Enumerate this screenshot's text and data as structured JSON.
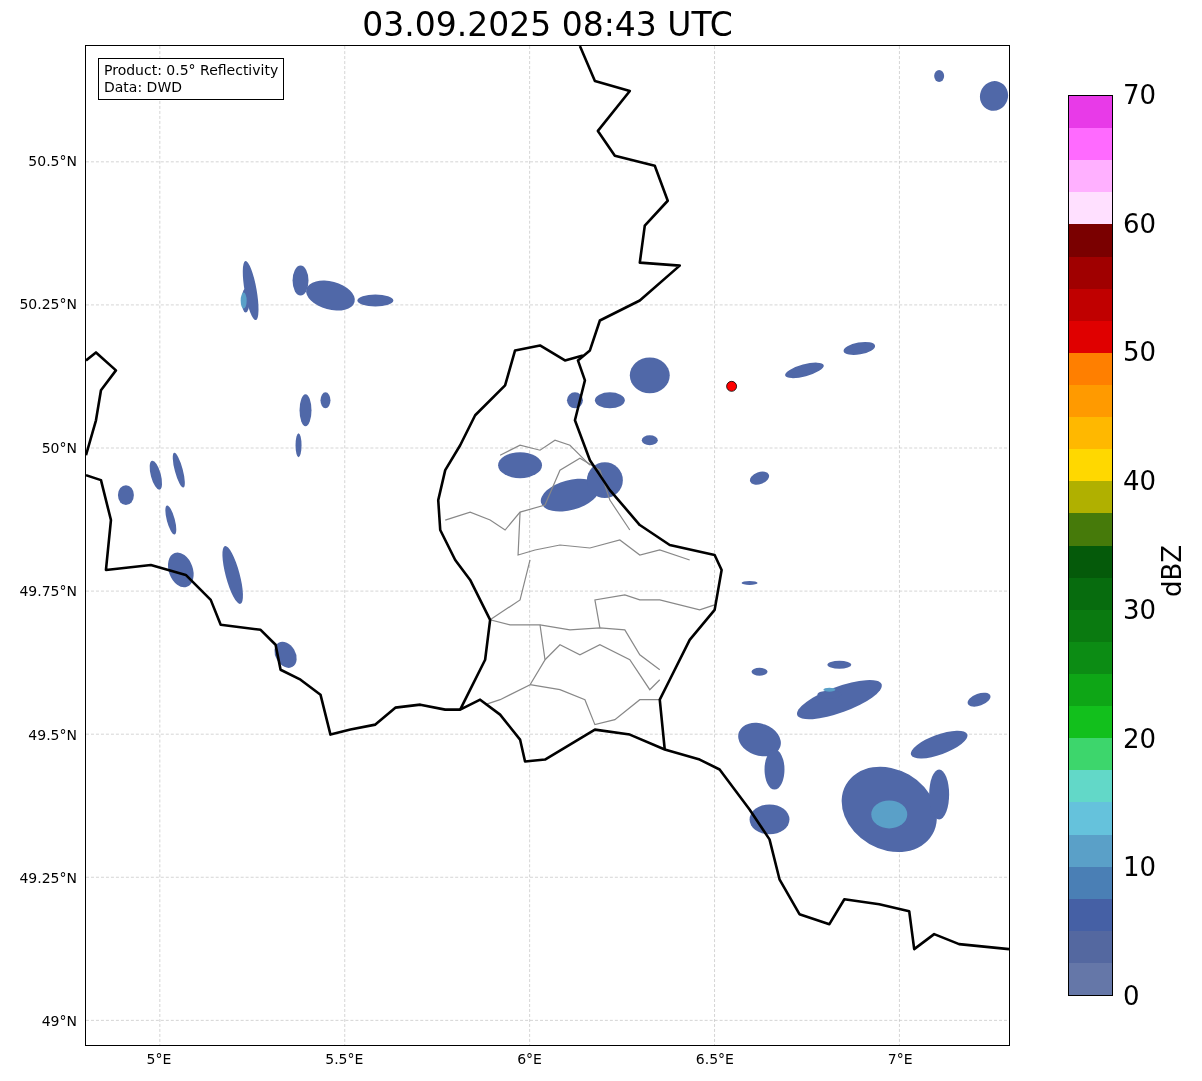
{
  "title": "03.09.2025 08:43 UTC",
  "legend": {
    "lines": [
      "Product: 0.5° Reflectivity",
      "Data: DWD"
    ]
  },
  "lat_ticks": [
    "50.5°N",
    "50.25°N",
    "50°N",
    "49.75°N",
    "49.5°N",
    "49.25°N",
    "49°N"
  ],
  "lon_ticks": [
    "5°E",
    "5.5°E",
    "6°E",
    "6.5°E",
    "7°E"
  ],
  "colorbar": {
    "label": "dBZ",
    "ticks": [
      "70",
      "60",
      "50",
      "40",
      "30",
      "20",
      "10",
      "0"
    ],
    "segments": [
      {
        "color": "#e83ae8"
      },
      {
        "color": "#ff6aff"
      },
      {
        "color": "#ffb0ff"
      },
      {
        "color": "#ffe0ff"
      },
      {
        "color": "#7a0000"
      },
      {
        "color": "#a00000"
      },
      {
        "color": "#c00000"
      },
      {
        "color": "#e00000"
      },
      {
        "color": "#ff7f00"
      },
      {
        "color": "#ff9a00"
      },
      {
        "color": "#ffb800"
      },
      {
        "color": "#ffd800"
      },
      {
        "color": "#b0b000"
      },
      {
        "color": "#467a0a"
      },
      {
        "color": "#055a0a"
      },
      {
        "color": "#076c0e"
      },
      {
        "color": "#0a7a10"
      },
      {
        "color": "#0c8c14"
      },
      {
        "color": "#0ea616"
      },
      {
        "color": "#12c01c"
      },
      {
        "color": "#3dd66c"
      },
      {
        "color": "#62d8c8"
      },
      {
        "color": "#65c2dc"
      },
      {
        "color": "#5aa0c8"
      },
      {
        "color": "#4a7fb5"
      },
      {
        "color": "#4560a5"
      },
      {
        "color": "#5468a0"
      },
      {
        "color": "#6577a8"
      }
    ]
  }
}
